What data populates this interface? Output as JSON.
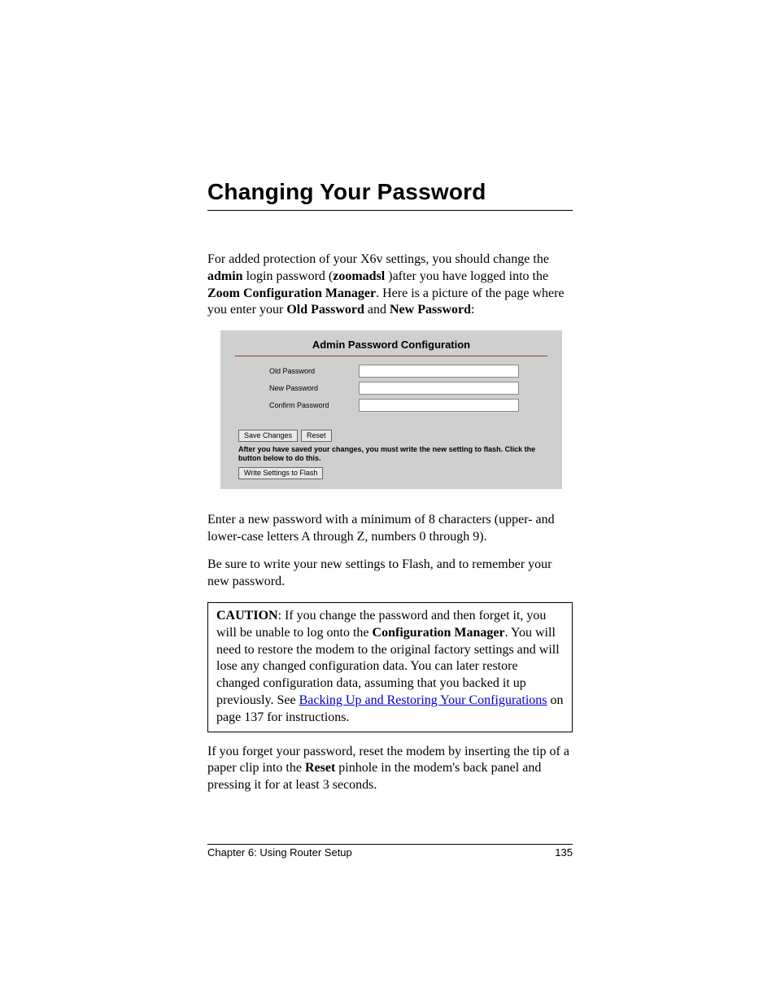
{
  "heading": "Changing Your Password",
  "intro": {
    "p1_a": "For added protection of your X6v settings, you should change the ",
    "p1_b": "admin",
    "p1_c": " login password (",
    "p1_d": "zoomadsl",
    "p1_e": " )after you have logged into the ",
    "p1_f": "Zoom Configuration Manager",
    "p1_g": ". Here is a picture of the page where you enter your ",
    "p1_h": "Old Password",
    "p1_i": " and ",
    "p1_j": "New Password",
    "p1_k": ":"
  },
  "screenshot": {
    "title": "Admin Password Configuration",
    "labels": {
      "old": "Old Password",
      "new": "New Password",
      "confirm": "Confirm Password"
    },
    "buttons": {
      "save": "Save Changes",
      "reset": "Reset",
      "write": "Write Settings to Flash"
    },
    "note": "After you have saved your changes, you must write the new setting to flash. Click the button below to do this."
  },
  "after1": "Enter a new password with a minimum of 8 characters (upper- and lower-case letters A through Z, numbers 0 through 9).",
  "after2": "Be sure to write your new settings to Flash, and to remember your new password.",
  "caution": {
    "label": "CAUTION",
    "a": ": If you change the password and then forget it, you will be unable to log onto the ",
    "b": "Configuration Manager",
    "c": ". You will need to restore the modem to the original factory settings and will lose any changed configuration data. You can later restore changed configuration data, assuming that you backed it up previously. See ",
    "link": "Backing Up and Restoring Your Configurations",
    "d": " on page 137 for instructions."
  },
  "forget": {
    "a": "If you forget your password, reset the modem by inserting the tip of a paper clip into the ",
    "b": "Reset",
    "c": " pinhole in the modem's back panel and pressing it for at least 3 seconds."
  },
  "footer": {
    "chapter": "Chapter 6: Using Router Setup",
    "page": "135"
  }
}
